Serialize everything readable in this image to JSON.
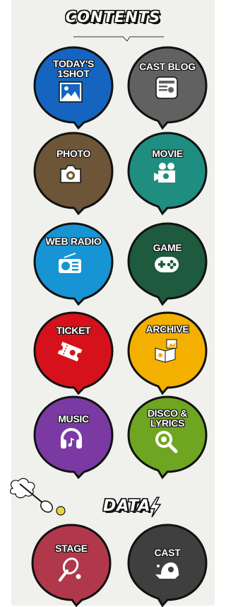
{
  "header": {
    "title": "CONTENTS"
  },
  "data_section": {
    "title": "DATA"
  },
  "menu": [
    {
      "label": "TODAY'S\n1SHOT",
      "color": "#1565c0",
      "icon": "image-icon"
    },
    {
      "label": "CAST BLOG",
      "color": "#616161",
      "icon": "blog-icon"
    },
    {
      "label": "PHOTO",
      "color": "#6d5538",
      "icon": "camera-icon"
    },
    {
      "label": "MOVIE",
      "color": "#1f8e80",
      "icon": "video-camera-icon"
    },
    {
      "label": "WEB RADIO",
      "color": "#1694d3",
      "icon": "radio-icon"
    },
    {
      "label": "GAME",
      "color": "#1d5a3e",
      "icon": "gamepad-icon"
    },
    {
      "label": "TICKET",
      "color": "#d5121b",
      "icon": "ticket-icon"
    },
    {
      "label": "ARCHIVE",
      "color": "#f4b000",
      "icon": "archive-book-icon"
    },
    {
      "label": "MUSIC",
      "color": "#7b3aa3",
      "icon": "headphones-icon"
    },
    {
      "label": "DISCO &\nLYRICS",
      "color": "#6ea521",
      "icon": "magnifier-icon"
    },
    {
      "label": "STAGE",
      "color": "#b0384a",
      "icon": "tennis-racket-icon"
    },
    {
      "label": "CAST",
      "color": "#3f3f3f",
      "icon": "cap-icon"
    }
  ]
}
